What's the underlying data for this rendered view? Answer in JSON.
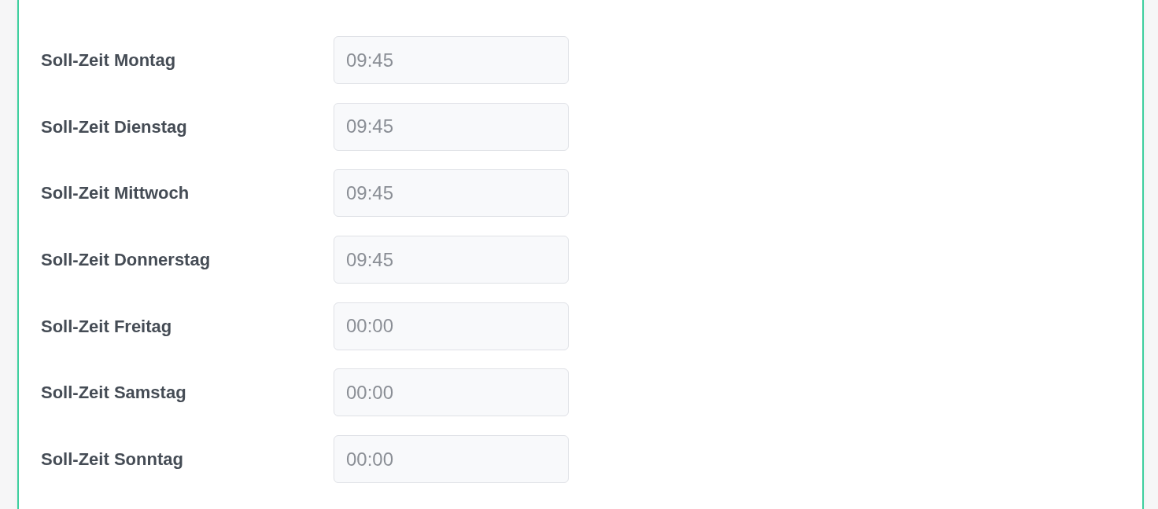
{
  "schedule": [
    {
      "label": "Soll-Zeit Montag",
      "value": "09:45"
    },
    {
      "label": "Soll-Zeit Dienstag",
      "value": "09:45"
    },
    {
      "label": "Soll-Zeit Mittwoch",
      "value": "09:45"
    },
    {
      "label": "Soll-Zeit Donnerstag",
      "value": "09:45"
    },
    {
      "label": "Soll-Zeit Freitag",
      "value": "00:00"
    },
    {
      "label": "Soll-Zeit Samstag",
      "value": "00:00"
    },
    {
      "label": "Soll-Zeit Sonntag",
      "value": "00:00"
    }
  ]
}
